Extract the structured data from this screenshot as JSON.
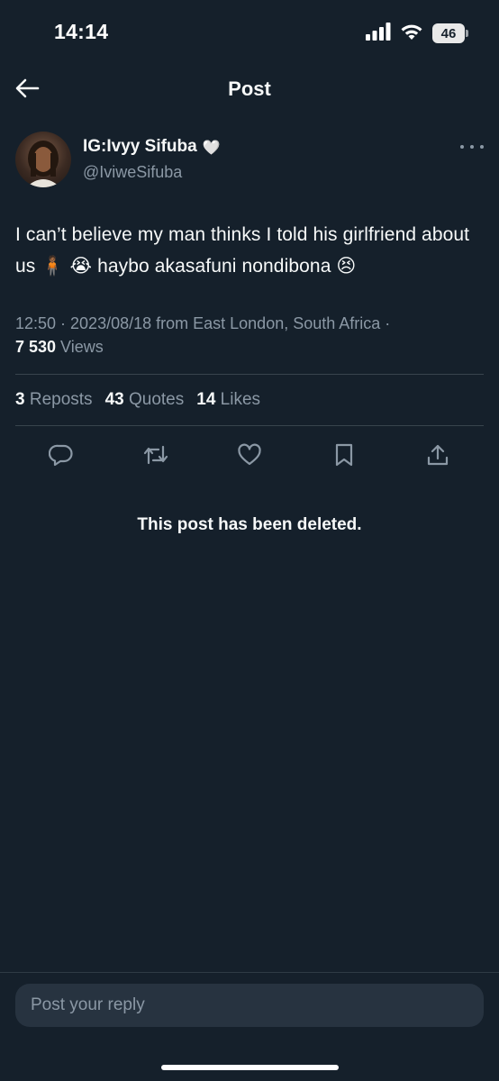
{
  "status_bar": {
    "time": "14:14",
    "battery": "46",
    "icons": [
      "signal-icon",
      "wifi-icon",
      "battery-icon"
    ]
  },
  "nav": {
    "title": "Post",
    "back_icon": "back-arrow-icon"
  },
  "post": {
    "author_name": "IG:Ivyy Sifuba",
    "author_heart": "🤍",
    "author_handle": "@IviweSifuba",
    "text_part1": "I can’t believe my man thinks I told his girlfriend about us ",
    "emoji_person": "🧍🏾",
    "emoji_cry": "😭",
    "text_part2": " haybo akasafuni nondibona ",
    "emoji_persevere": "😣",
    "meta_line": "12:50 · 2023/08/18 from East London, South Africa ·",
    "views_count": "7 530",
    "views_label": " Views"
  },
  "stats": {
    "reposts_count": "3",
    "reposts_label": "Reposts",
    "quotes_count": "43",
    "quotes_label": "Quotes",
    "likes_count": "14",
    "likes_label": "Likes"
  },
  "actions": [
    "reply-icon",
    "repost-icon",
    "like-icon",
    "bookmark-icon",
    "share-icon"
  ],
  "deleted_message": "This post has been deleted.",
  "reply": {
    "placeholder": "Post your reply"
  },
  "colors": {
    "background": "#15202b",
    "text": "#f7f9f9",
    "secondary_text": "#8b98a5",
    "divider": "#38444d",
    "reply_box": "#273340"
  }
}
